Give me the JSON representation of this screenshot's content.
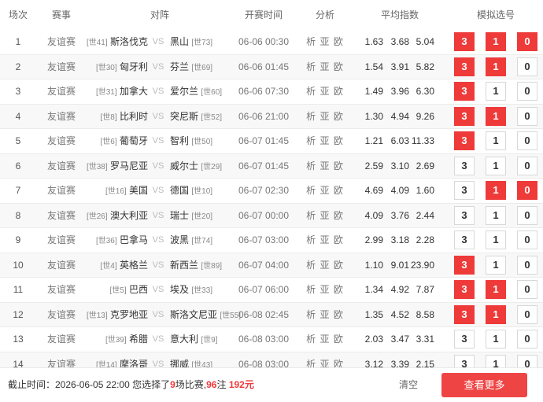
{
  "header": {
    "num": "场次",
    "league": "赛事",
    "match": "对阵",
    "time": "开赛时间",
    "analysis": "分析",
    "odds": "平均指数",
    "picks": "模拟选号"
  },
  "vs_text": "VS",
  "pick_labels": [
    "3",
    "1",
    "0"
  ],
  "matches": [
    {
      "num": "1",
      "league": "友谊赛",
      "home_rank": "[世41]",
      "home": "斯洛伐克",
      "away": "黑山",
      "away_rank": "[世73]",
      "time": "06-06 00:30",
      "analysis": "析 亚 欧",
      "odds": [
        "1.63",
        "3.68",
        "5.04"
      ],
      "selected": [
        true,
        true,
        true
      ]
    },
    {
      "num": "2",
      "league": "友谊赛",
      "home_rank": "[世30]",
      "home": "匈牙利",
      "away": "芬兰",
      "away_rank": "[世69]",
      "time": "06-06 01:45",
      "analysis": "析 亚 欧",
      "odds": [
        "1.54",
        "3.91",
        "5.82"
      ],
      "selected": [
        true,
        true,
        false
      ]
    },
    {
      "num": "3",
      "league": "友谊赛",
      "home_rank": "[世31]",
      "home": "加拿大",
      "away": "爱尔兰",
      "away_rank": "[世60]",
      "time": "06-06 07:30",
      "analysis": "析 亚 欧",
      "odds": [
        "1.49",
        "3.96",
        "6.30"
      ],
      "selected": [
        true,
        false,
        false
      ]
    },
    {
      "num": "4",
      "league": "友谊赛",
      "home_rank": "[世8]",
      "home": "比利时",
      "away": "突尼斯",
      "away_rank": "[世52]",
      "time": "06-06 21:00",
      "analysis": "析 亚 欧",
      "odds": [
        "1.30",
        "4.94",
        "9.26"
      ],
      "selected": [
        true,
        true,
        false
      ]
    },
    {
      "num": "5",
      "league": "友谊赛",
      "home_rank": "[世6]",
      "home": "葡萄牙",
      "away": "智利",
      "away_rank": "[世50]",
      "time": "06-07 01:45",
      "analysis": "析 亚 欧",
      "odds": [
        "1.21",
        "6.03",
        "11.33"
      ],
      "selected": [
        true,
        false,
        false
      ]
    },
    {
      "num": "6",
      "league": "友谊赛",
      "home_rank": "[世38]",
      "home": "罗马尼亚",
      "away": "威尔士",
      "away_rank": "[世29]",
      "time": "06-07 01:45",
      "analysis": "析 亚 欧",
      "odds": [
        "2.59",
        "3.10",
        "2.69"
      ],
      "selected": [
        false,
        false,
        false
      ]
    },
    {
      "num": "7",
      "league": "友谊赛",
      "home_rank": "[世16]",
      "home": "美国",
      "away": "德国",
      "away_rank": "[世10]",
      "time": "06-07 02:30",
      "analysis": "析 亚 欧",
      "odds": [
        "4.69",
        "4.09",
        "1.60"
      ],
      "selected": [
        false,
        true,
        true
      ]
    },
    {
      "num": "8",
      "league": "友谊赛",
      "home_rank": "[世26]",
      "home": "澳大利亚",
      "away": "瑞士",
      "away_rank": "[世20]",
      "time": "06-07 00:00",
      "analysis": "析 亚 欧",
      "odds": [
        "4.09",
        "3.76",
        "2.44"
      ],
      "selected": [
        false,
        false,
        false
      ]
    },
    {
      "num": "9",
      "league": "友谊赛",
      "home_rank": "[世36]",
      "home": "巴拿马",
      "away": "波黑",
      "away_rank": "[世74]",
      "time": "06-07 03:00",
      "analysis": "析 亚 欧",
      "odds": [
        "2.99",
        "3.18",
        "2.28"
      ],
      "selected": [
        false,
        false,
        false
      ]
    },
    {
      "num": "10",
      "league": "友谊赛",
      "home_rank": "[世4]",
      "home": "英格兰",
      "away": "新西兰",
      "away_rank": "[世89]",
      "time": "06-07 04:00",
      "analysis": "析 亚 欧",
      "odds": [
        "1.10",
        "9.01",
        "23.90"
      ],
      "selected": [
        true,
        false,
        false
      ]
    },
    {
      "num": "11",
      "league": "友谊赛",
      "home_rank": "[世5]",
      "home": "巴西",
      "away": "埃及",
      "away_rank": "[世33]",
      "time": "06-07 06:00",
      "analysis": "析 亚 欧",
      "odds": [
        "1.34",
        "4.92",
        "7.87"
      ],
      "selected": [
        true,
        true,
        false
      ]
    },
    {
      "num": "12",
      "league": "友谊赛",
      "home_rank": "[世13]",
      "home": "克罗地亚",
      "away": "斯洛文尼亚",
      "away_rank": "[世55]",
      "time": "06-08 02:45",
      "analysis": "析 亚 欧",
      "odds": [
        "1.35",
        "4.52",
        "8.58"
      ],
      "selected": [
        true,
        true,
        false
      ]
    },
    {
      "num": "13",
      "league": "友谊赛",
      "home_rank": "[世39]",
      "home": "希腊",
      "away": "意大利",
      "away_rank": "[世9]",
      "time": "06-08 03:00",
      "analysis": "析 亚 欧",
      "odds": [
        "2.03",
        "3.47",
        "3.31"
      ],
      "selected": [
        false,
        false,
        false
      ]
    },
    {
      "num": "14",
      "league": "友谊赛",
      "home_rank": "[世14]",
      "home": "摩洛哥",
      "away": "挪威",
      "away_rank": "[世43]",
      "time": "06-08 03:00",
      "analysis": "析 亚 欧",
      "odds": [
        "3.12",
        "3.39",
        "2.15"
      ],
      "selected": [
        false,
        false,
        false
      ]
    }
  ],
  "footer": {
    "deadline_prefix": "截止时间：2026-06-05 22:00 您选择了",
    "count": "9",
    "mid": "场比赛,",
    "bets": "96",
    "mid2": "注 ",
    "amount": "192元",
    "clear": "清空",
    "more": "查看更多"
  },
  "colors": {
    "accent": "#ef3a3a",
    "alt_row": "#f8f8f8"
  }
}
